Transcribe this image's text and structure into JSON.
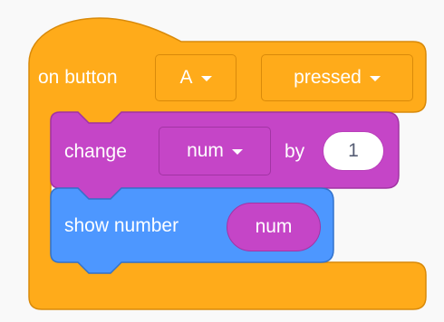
{
  "hat_block": {
    "label": "on button",
    "button_dropdown": "A",
    "event_dropdown": "pressed",
    "color": "#ffab1a",
    "border_color": "#d98a0a"
  },
  "change_block": {
    "label": "change",
    "variable_dropdown": "num",
    "by_label": "by",
    "amount_input": "1",
    "color": "#c545c7",
    "border_color": "#a234a4"
  },
  "show_block": {
    "label": "show number",
    "value_reporter": "num",
    "color": "#4d97ff",
    "border_color": "#3373cc"
  },
  "icons": {
    "dropdown": "caret-down-icon"
  }
}
